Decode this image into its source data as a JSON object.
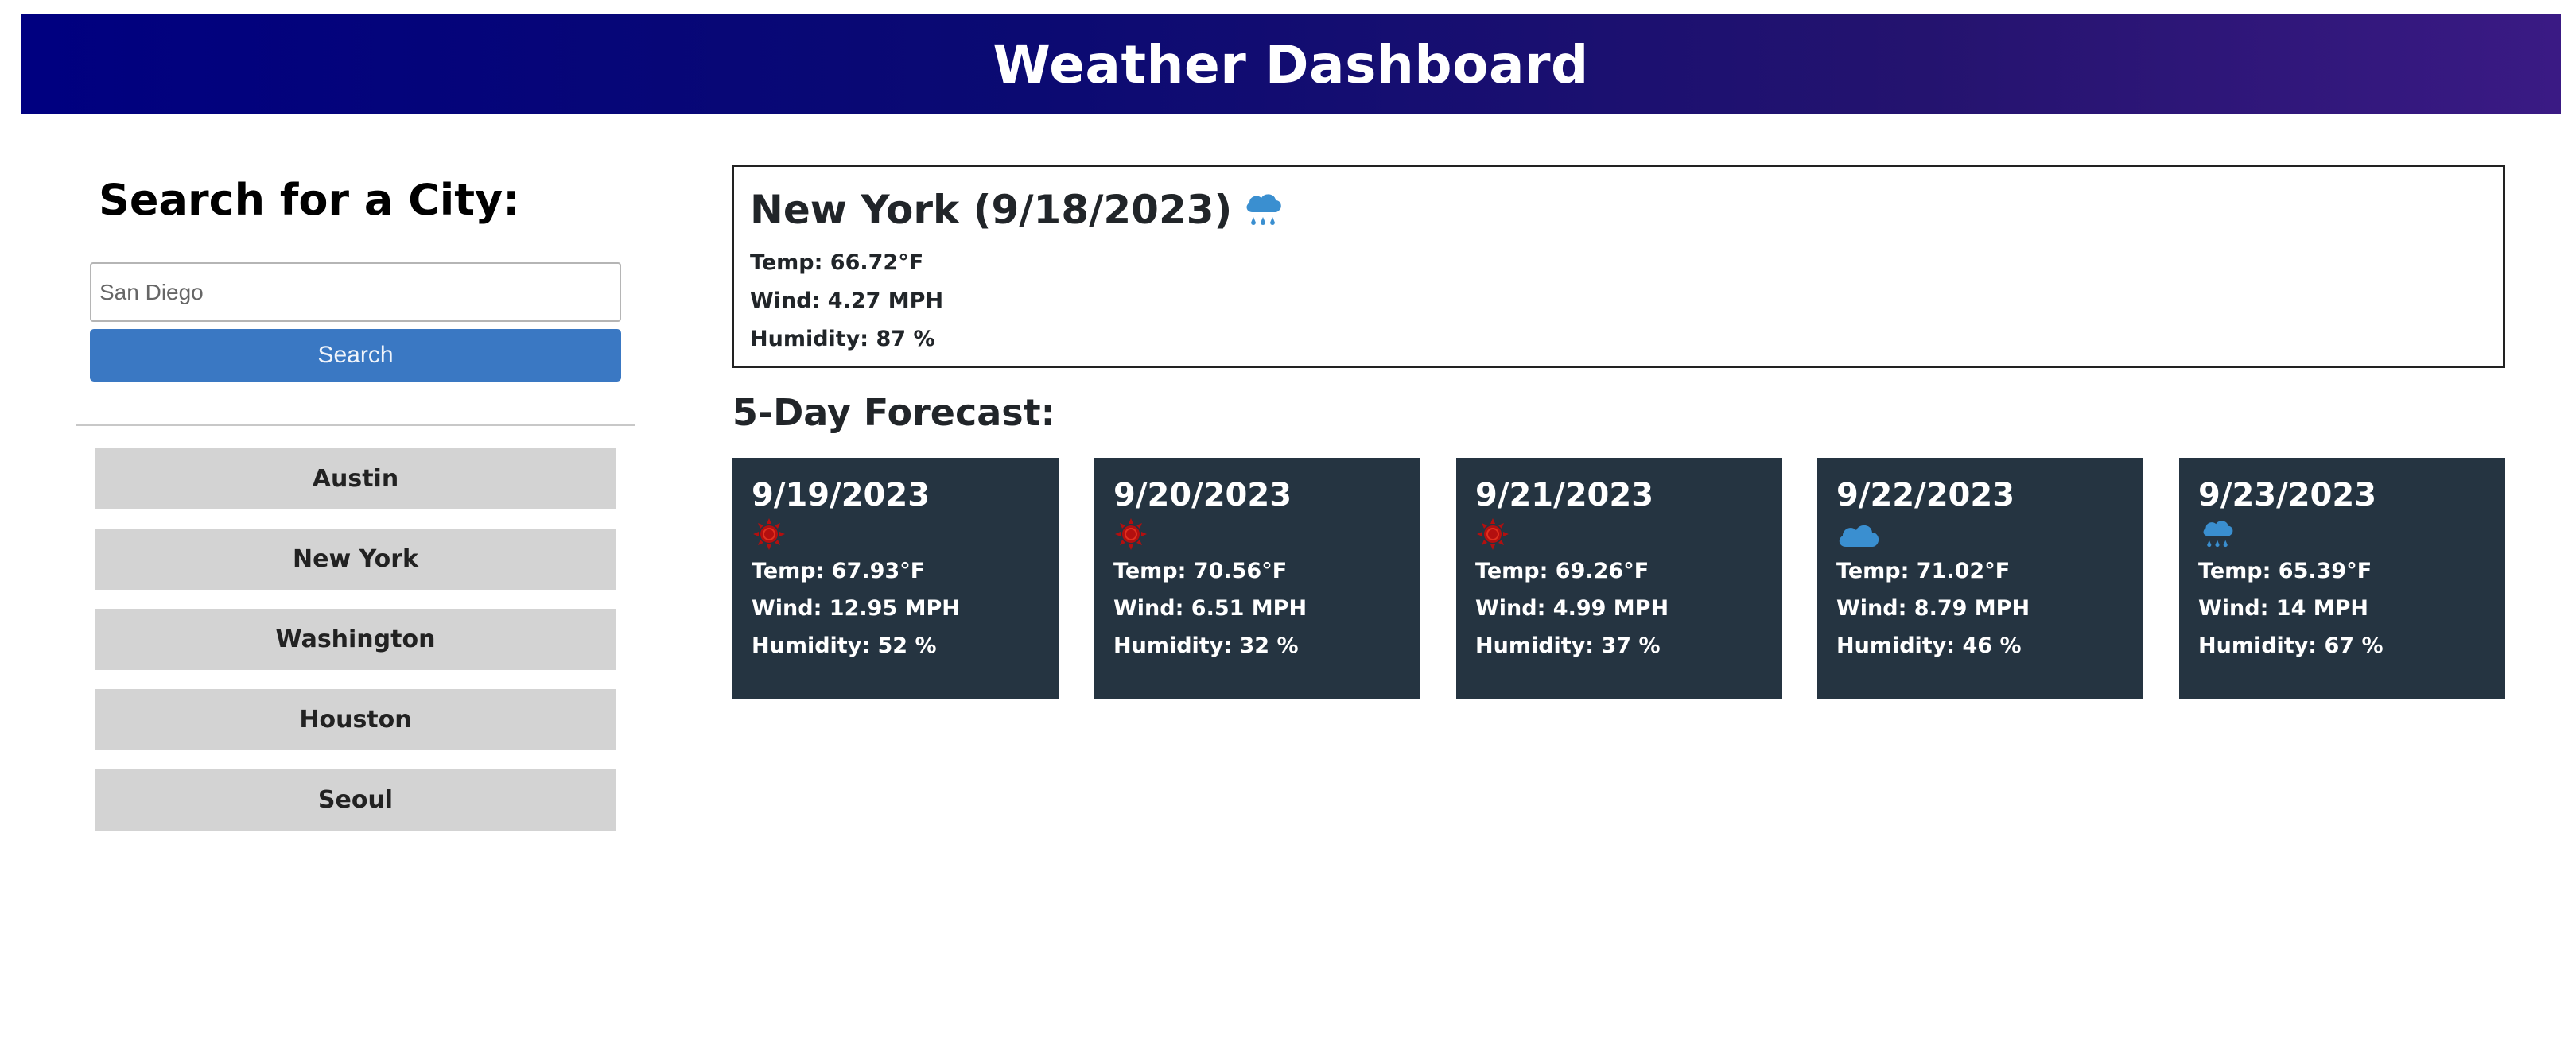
{
  "header": {
    "title": "Weather Dashboard"
  },
  "sidebar": {
    "heading": "Search for a City:",
    "search": {
      "value": "San Diego",
      "placeholder": "San Diego"
    },
    "search_button": "Search",
    "history": [
      {
        "label": "Austin"
      },
      {
        "label": "New York"
      },
      {
        "label": "Washington"
      },
      {
        "label": "Houston"
      },
      {
        "label": "Seoul"
      }
    ]
  },
  "current": {
    "title": "New York (9/18/2023)",
    "icon": "rain-cloud-icon",
    "temp": "Temp: 66.72°F",
    "wind": "Wind: 4.27 MPH",
    "humidity": "Humidity: 87 %"
  },
  "forecast": {
    "heading": "5-Day Forecast:",
    "days": [
      {
        "date": "9/19/2023",
        "icon": "sun-icon",
        "temp": "Temp: 67.93°F",
        "wind": "Wind: 12.95 MPH",
        "humidity": "Humidity: 52 %"
      },
      {
        "date": "9/20/2023",
        "icon": "sun-icon",
        "temp": "Temp: 70.56°F",
        "wind": "Wind: 6.51 MPH",
        "humidity": "Humidity: 32 %"
      },
      {
        "date": "9/21/2023",
        "icon": "sun-icon",
        "temp": "Temp: 69.26°F",
        "wind": "Wind: 4.99 MPH",
        "humidity": "Humidity: 37 %"
      },
      {
        "date": "9/22/2023",
        "icon": "cloud-icon",
        "temp": "Temp: 71.02°F",
        "wind": "Wind: 8.79 MPH",
        "humidity": "Humidity: 46 %"
      },
      {
        "date": "9/23/2023",
        "icon": "rain-cloud-icon",
        "temp": "Temp: 65.39°F",
        "wind": "Wind: 14 MPH",
        "humidity": "Humidity: 67 %"
      }
    ]
  },
  "colors": {
    "header_gradient_start": "#000080",
    "header_gradient_end": "#3a1a84",
    "search_button": "#3a78c3",
    "history_button": "#d3d3d3",
    "forecast_card": "#253441",
    "sun_icon": "#b30f0f",
    "cloud_icon": "#3a8fd0"
  }
}
